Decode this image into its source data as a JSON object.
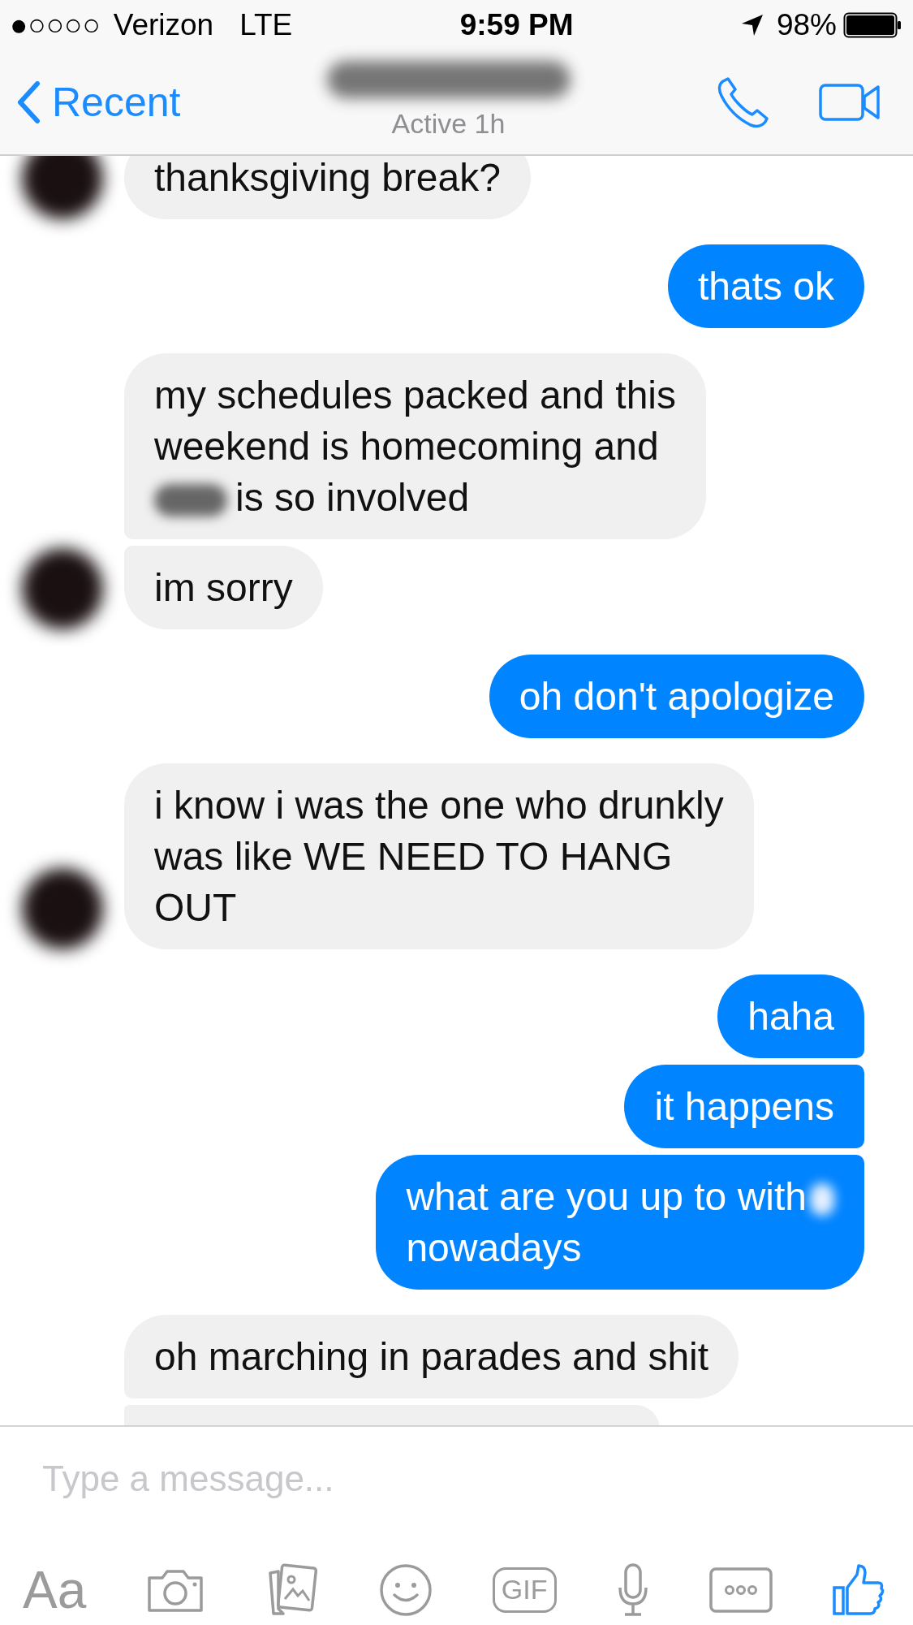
{
  "status_bar": {
    "signal": "●○○○○",
    "carrier": "Verizon",
    "network": "LTE",
    "time": "9:59 PM",
    "battery": "98%"
  },
  "header": {
    "back": "Recent",
    "name_redacted": true,
    "subtitle": "Active 1h"
  },
  "messages": [
    {
      "kind": "incoming",
      "avatar": true,
      "lines": [
        "thanksgiving break?"
      ]
    },
    {
      "kind": "outgoing",
      "lines": [
        "thats ok"
      ]
    },
    {
      "kind": "incoming",
      "lines": [
        "my schedules packed and this",
        "weekend is homecoming and",
        {
          "text": "is so involved",
          "smudge_before": true
        }
      ]
    },
    {
      "kind": "incoming",
      "avatar": true,
      "lines": [
        "im sorry"
      ]
    },
    {
      "kind": "outgoing",
      "lines": [
        "oh don't apologize"
      ]
    },
    {
      "kind": "incoming",
      "avatar": true,
      "lines": [
        "i know i was the one who drunkly",
        "was like WE NEED TO HANG",
        "OUT"
      ]
    },
    {
      "kind": "outgoing",
      "lines": [
        "haha"
      ]
    },
    {
      "kind": "outgoing",
      "lines": [
        "it happens"
      ]
    },
    {
      "kind": "outgoing",
      "lines": [
        {
          "text": "what are you up to with",
          "smudge_after": true
        },
        "nowadays"
      ]
    },
    {
      "kind": "incoming",
      "lines": [
        "oh marching in parades and shit"
      ]
    },
    {
      "kind": "cutoff"
    }
  ],
  "composer": {
    "placeholder": "Type a message...",
    "text_button": "Aa",
    "gif_button": "GIF"
  }
}
